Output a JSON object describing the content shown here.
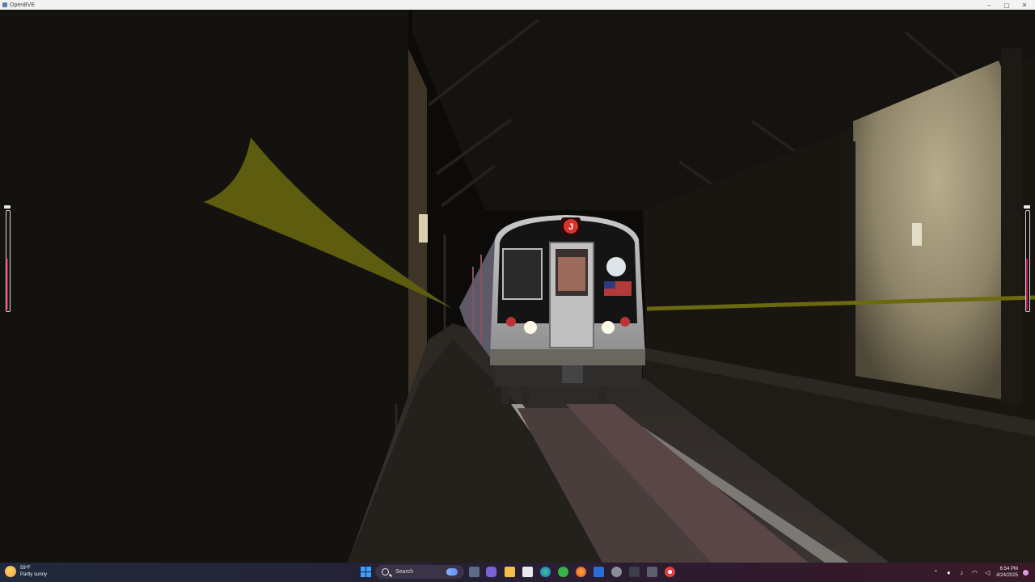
{
  "window": {
    "title": "OpenBVE",
    "minimize_glyph": "–",
    "maximize_glyph": "▢",
    "close_glyph": "✕"
  },
  "scene": {
    "route_bullet": "J",
    "bullet_color": "#d9342b",
    "cable_color": "#6b6a10"
  },
  "gauges": {
    "left_level": 0.52,
    "right_level": 0.52,
    "fill_color": "#c2185b"
  },
  "taskbar": {
    "weather": {
      "temp": "59°F",
      "condition": "Partly sunny"
    },
    "search_placeholder": "Search",
    "clock": {
      "time": "6:54 PM",
      "date": "4/24/2025"
    },
    "pinned_icons": [
      "copilot-icon",
      "task-view-icon",
      "chat-icon",
      "file-explorer-icon",
      "store-icon",
      "edge-icon",
      "xbox-icon",
      "firefox-icon",
      "word-icon",
      "settings-icon",
      "terminal-icon",
      "chrome-icon"
    ],
    "tray_icons": [
      "chevron-up-icon",
      "app-tray-icon",
      "mic-icon",
      "network-icon",
      "volume-icon"
    ]
  }
}
